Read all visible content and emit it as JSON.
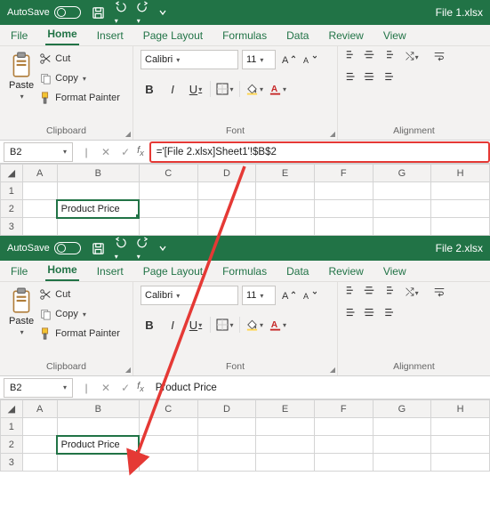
{
  "windows": [
    {
      "filename": "File 1.xlsx",
      "autosave": "AutoSave",
      "tabs": {
        "file": "File",
        "home": "Home",
        "insert": "Insert",
        "pagelayout": "Page Layout",
        "formulas": "Formulas",
        "data": "Data",
        "review": "Review",
        "view": "View"
      },
      "clipboard": {
        "paste": "Paste",
        "cut": "Cut",
        "copy": "Copy",
        "fmtpainter": "Format Painter",
        "label": "Clipboard"
      },
      "font": {
        "name": "Calibri",
        "size": "11",
        "label": "Font"
      },
      "alignment": {
        "label": "Alignment"
      },
      "namebox": "B2",
      "formula": "='[File 2.xlsx]Sheet1'!$B$2",
      "highlight_formula": true,
      "columns": [
        "A",
        "B",
        "C",
        "D",
        "E",
        "F",
        "G",
        "H"
      ],
      "rows": [
        "1",
        "2",
        "3"
      ],
      "selected_cell": "B2",
      "cell_value": "Product Price"
    },
    {
      "filename": "File 2.xlsx",
      "autosave": "AutoSave",
      "tabs": {
        "file": "File",
        "home": "Home",
        "insert": "Insert",
        "pagelayout": "Page Layout",
        "formulas": "Formulas",
        "data": "Data",
        "review": "Review",
        "view": "View"
      },
      "clipboard": {
        "paste": "Paste",
        "cut": "Cut",
        "copy": "Copy",
        "fmtpainter": "Format Painter",
        "label": "Clipboard"
      },
      "font": {
        "name": "Calibri",
        "size": "11",
        "label": "Font"
      },
      "alignment": {
        "label": "Alignment"
      },
      "namebox": "B2",
      "formula": "Product Price",
      "highlight_formula": false,
      "columns": [
        "A",
        "B",
        "C",
        "D",
        "E",
        "F",
        "G",
        "H"
      ],
      "rows": [
        "1",
        "2",
        "3"
      ],
      "selected_cell": "B2",
      "cell_value": "Product Price"
    }
  ],
  "accent": "#217346",
  "highlight": "#e53935"
}
